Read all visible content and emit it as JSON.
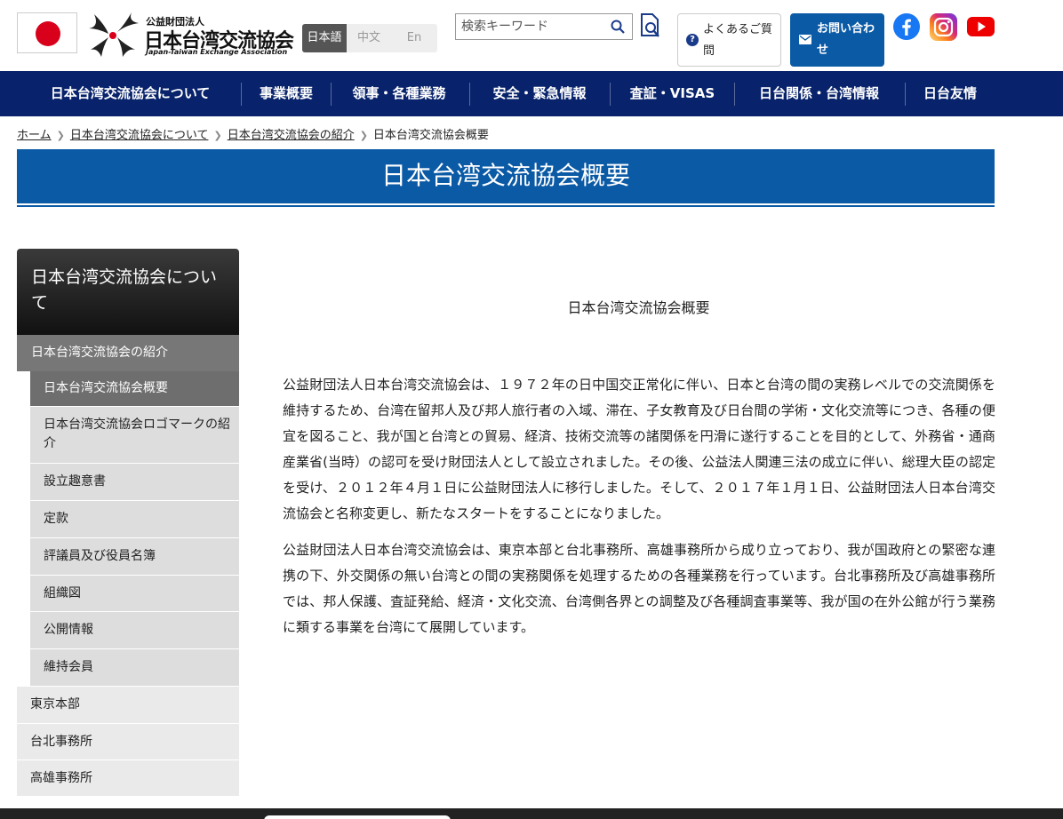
{
  "header": {
    "logo_sub": "公益財団法人",
    "logo_main": "日本台湾交流協会",
    "logo_en": "Japan-Taiwan Exchange Association",
    "languages": [
      {
        "label": "日本語",
        "active": true
      },
      {
        "label": "中文",
        "active": false
      },
      {
        "label": "En",
        "active": false
      }
    ],
    "search_placeholder": "検索キーワード",
    "faq_label": "よくあるご質問",
    "contact_label": "お問い合わせ",
    "social": [
      "facebook-icon",
      "instagram-icon",
      "youtube-icon"
    ]
  },
  "nav": {
    "items": [
      "日本台湾交流協会について",
      "事業概要",
      "領事・各種業務",
      "安全・緊急情報",
      "査証・VISAS",
      "日台関係・台湾情報",
      "日台友情"
    ]
  },
  "breadcrumb": {
    "links": [
      "ホーム",
      "日本台湾交流協会について",
      "日本台湾交流協会の紹介"
    ],
    "current": "日本台湾交流協会概要"
  },
  "page_title": "日本台湾交流協会概要",
  "sidebar": {
    "heading": "日本台湾交流協会について",
    "section": "日本台湾交流協会の紹介",
    "children": [
      {
        "label": "日本台湾交流協会概要",
        "active": true
      },
      {
        "label": "日本台湾交流協会ロゴマークの紹介",
        "active": false
      },
      {
        "label": "設立趣意書",
        "active": false
      },
      {
        "label": "定款",
        "active": false
      },
      {
        "label": "評議員及び役員名簿",
        "active": false
      },
      {
        "label": "組織図",
        "active": false
      },
      {
        "label": "公開情報",
        "active": false
      },
      {
        "label": "維持会員",
        "active": false
      }
    ],
    "others": [
      "東京本部",
      "台北事務所",
      "高雄事務所"
    ]
  },
  "main": {
    "heading": "日本台湾交流協会概要",
    "paragraphs": [
      "公益財団法人日本台湾交流協会は、１９７２年の日中国交正常化に伴い、日本と台湾の間の実務レベルでの交流関係を維持するため、台湾在留邦人及び邦人旅行者の入域、滞在、子女教育及び日台間の学術・文化交流等につき、各種の便宜を図ること、我が国と台湾との貿易、経済、技術交流等の諸関係を円滑に遂行することを目的として、外務省・通商産業省(当時）の認可を受け財団法人として設立されました。その後、公益法人関連三法の成立に伴い、総理大臣の認定を受け、２０１２年４月１日に公益財団法人に移行しました。そして、２０１７年１月１日、公益財団法人日本台湾交流協会と名称変更し、新たなスタートをすることになりました。",
      "公益財団法人日本台湾交流協会は、東京本部と台北事務所、高雄事務所から成り立っており、我が国政府との緊密な連携の下、外交関係の無い台湾との間の実務関係を処理するための各種業務を行っています。台北事務所及び高雄事務所では、邦人保護、査証発給、経済・文化交流、台湾側各界との調整及び各種調査事業等、我が国の在外公館が行う業務に類する事業を台湾にて展開しています。"
    ]
  },
  "colors": {
    "nav_bg": "#08236b",
    "accent_blue": "#0b5aa6",
    "flag_red": "#d9001b"
  }
}
